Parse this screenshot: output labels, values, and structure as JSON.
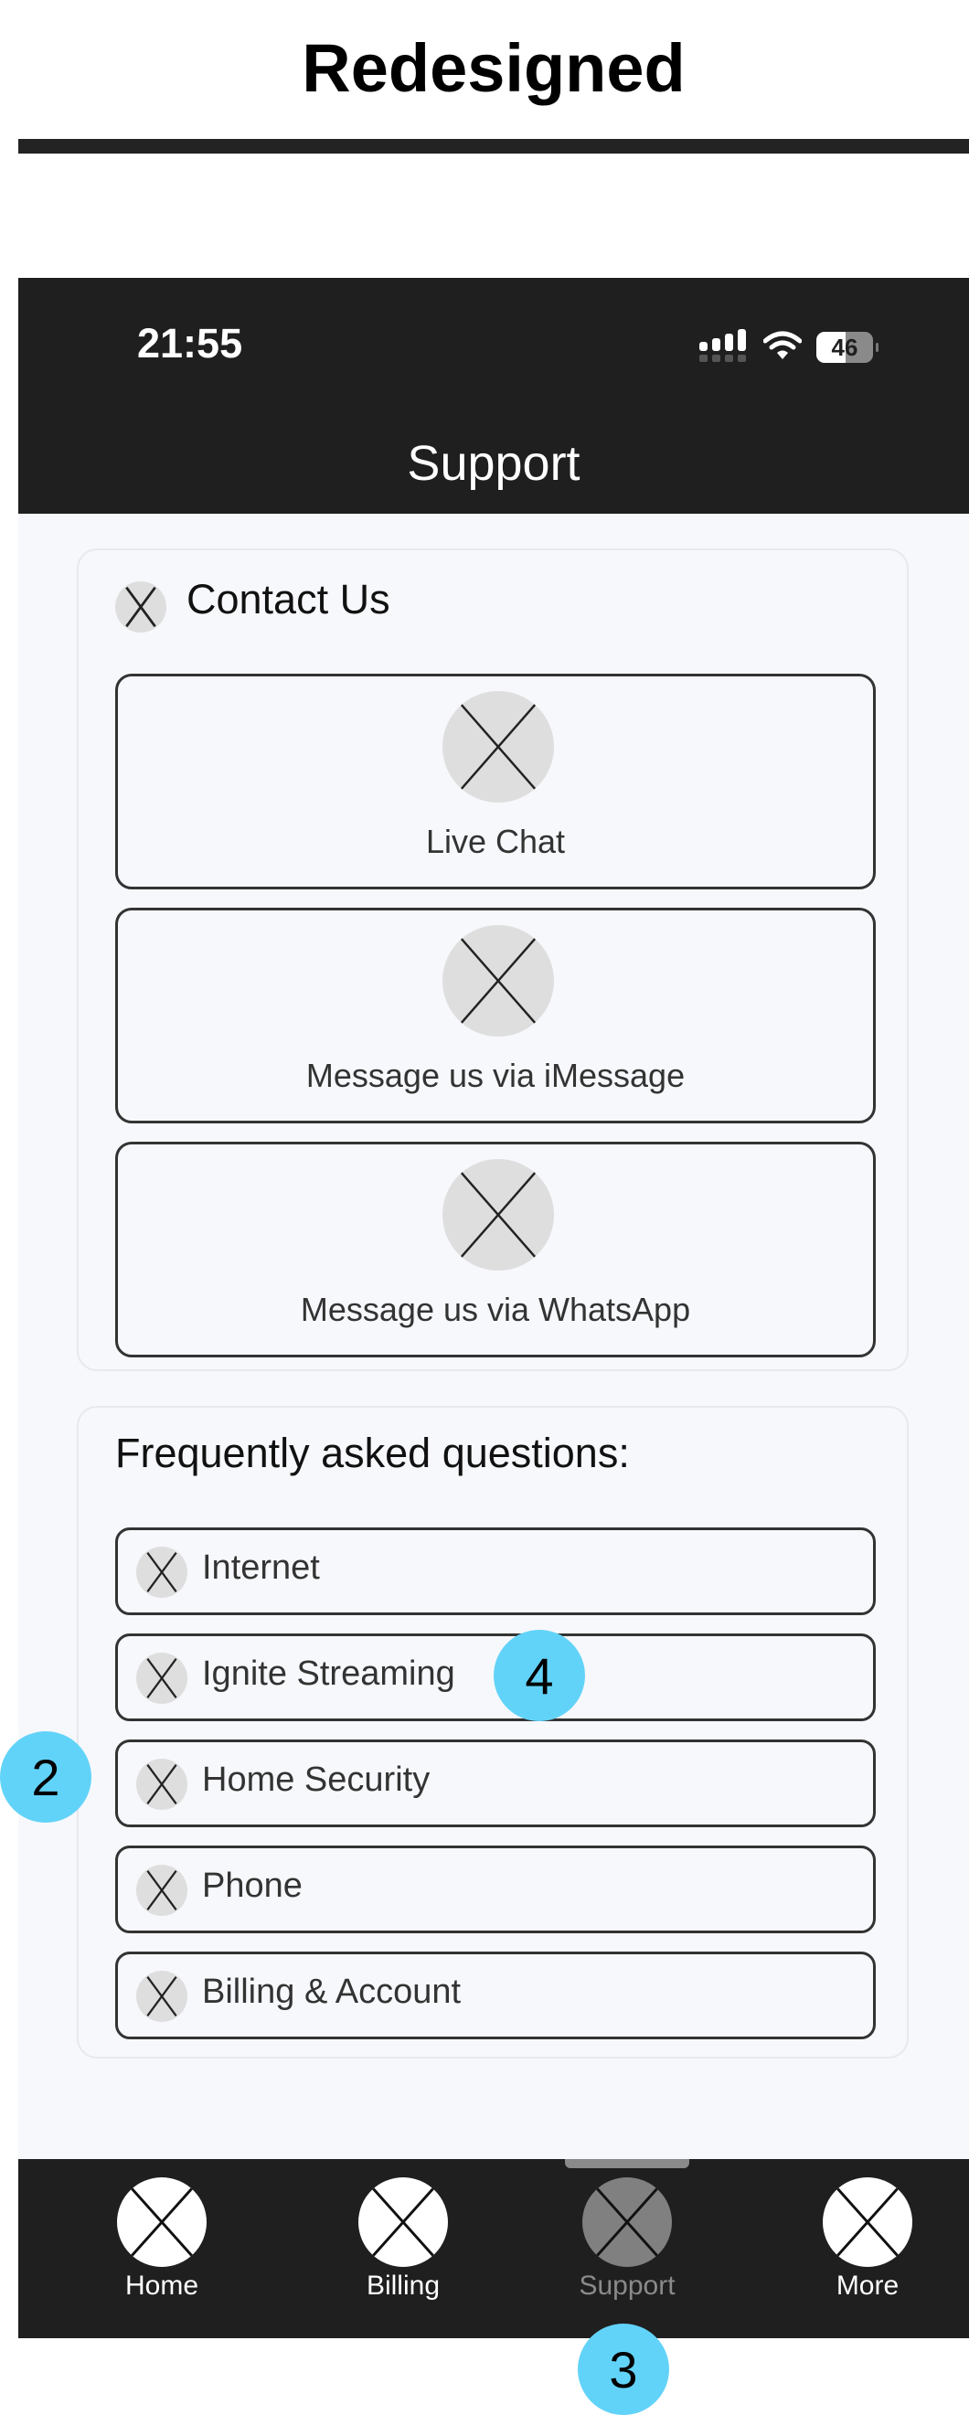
{
  "page": {
    "title": "Redesigned"
  },
  "status_bar": {
    "time": "21:55",
    "battery_level": "46",
    "battery_percent": 46
  },
  "nav": {
    "title": "Support"
  },
  "contact": {
    "title": "Contact Us",
    "options": [
      {
        "label": "Live Chat",
        "icon": "placeholder-icon"
      },
      {
        "label": "Message us via iMessage",
        "icon": "placeholder-icon"
      },
      {
        "label": "Message us via WhatsApp",
        "icon": "placeholder-icon"
      }
    ]
  },
  "faq": {
    "title": "Frequently asked questions:",
    "items": [
      {
        "label": "Internet"
      },
      {
        "label": "Ignite Streaming"
      },
      {
        "label": "Home Security"
      },
      {
        "label": "Phone"
      },
      {
        "label": "Billing & Account"
      }
    ]
  },
  "tabbar": {
    "active": "Support",
    "tabs": [
      {
        "label": "Home"
      },
      {
        "label": "Billing"
      },
      {
        "label": "Support"
      },
      {
        "label": "More"
      }
    ]
  },
  "annotations": [
    {
      "number": "2"
    },
    {
      "number": "3"
    },
    {
      "number": "4"
    }
  ],
  "colors": {
    "header_bg": "#1f1f1f",
    "content_bg": "#f7f8fc",
    "annotation_badge": "#62d3f8",
    "inactive_tab": "#808080"
  }
}
